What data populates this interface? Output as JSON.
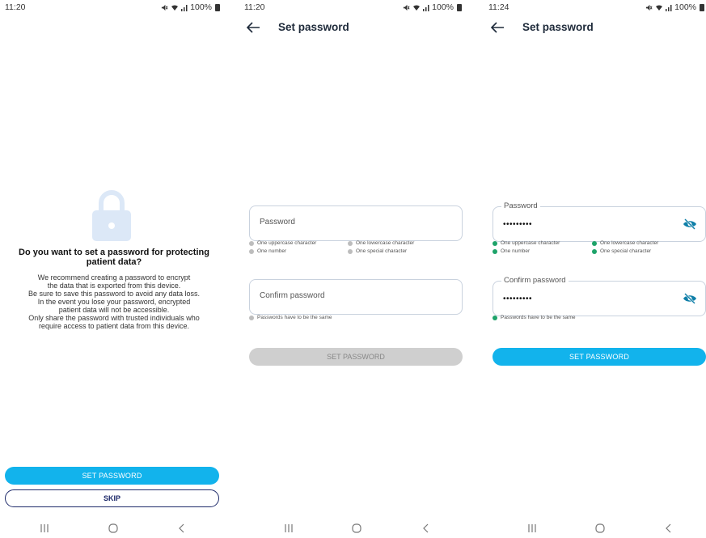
{
  "screens": [
    {
      "status": {
        "time": "11:20",
        "battery": "100%"
      },
      "prompt": {
        "title": "Do you want to set a password for protecting patient data?",
        "body_lines": [
          "We recommend creating a password to encrypt",
          "the data that is exported from this device.",
          "Be sure to save this password to avoid any data loss.",
          "In the event you lose your password, encrypted",
          "patient data will not be accessible.",
          "Only share the password with trusted individuals who",
          "require access to patient data from this device."
        ]
      },
      "buttons": {
        "set_password": "SET PASSWORD",
        "skip": "SKIP"
      }
    },
    {
      "status": {
        "time": "11:20",
        "battery": "100%"
      },
      "title": "Set password",
      "password_field": {
        "placeholder": "Password",
        "value": ""
      },
      "requirements": [
        {
          "label": "One uppercase character",
          "met": false
        },
        {
          "label": "One lowercase character",
          "met": false
        },
        {
          "label": "One number",
          "met": false
        },
        {
          "label": "One special character",
          "met": false
        }
      ],
      "confirm_field": {
        "placeholder": "Confirm password",
        "value": ""
      },
      "match_requirement": {
        "label": "Passwords have to be the same",
        "met": false
      },
      "submit": {
        "label": "SET PASSWORD",
        "enabled": false
      }
    },
    {
      "status": {
        "time": "11:24",
        "battery": "100%"
      },
      "title": "Set password",
      "password_field": {
        "label": "Password",
        "value": "•••••••••"
      },
      "requirements": [
        {
          "label": "One uppercase character",
          "met": true
        },
        {
          "label": "One lowercase character",
          "met": true
        },
        {
          "label": "One number",
          "met": true
        },
        {
          "label": "One special character",
          "met": true
        }
      ],
      "confirm_field": {
        "label": "Confirm password",
        "value": "•••••••••"
      },
      "match_requirement": {
        "label": "Passwords have to be the same",
        "met": true
      },
      "submit": {
        "label": "SET PASSWORD",
        "enabled": true
      }
    }
  ],
  "colors": {
    "accent": "#12b3ec",
    "met": "#1ea36a",
    "unmet": "#bdbdbd",
    "disabled_button": "#cfcfcf",
    "outline": "#1e2a6a",
    "eye_icon": "#0f7fa8",
    "lock_icon": "#dce8f7"
  },
  "icons": {
    "back": "arrow-left-icon",
    "lock": "lock-icon",
    "eye": "eye-slash-icon",
    "nav_recents": "recents-icon",
    "nav_home": "home-icon",
    "nav_back": "nav-back-icon"
  }
}
